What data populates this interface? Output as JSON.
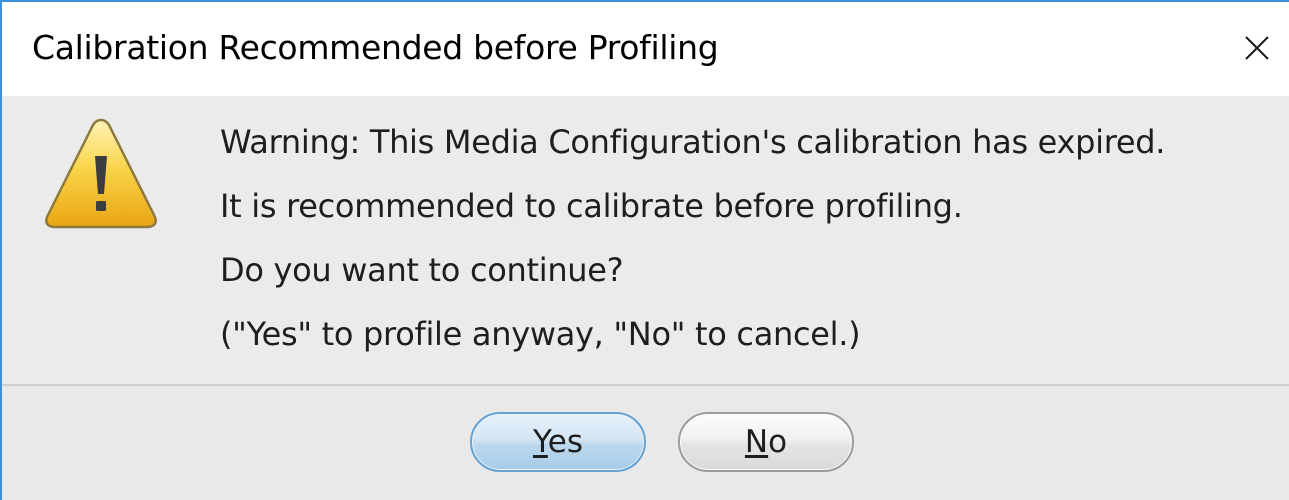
{
  "dialog": {
    "title": "Calibration Recommended before Profiling",
    "close_icon": "close-icon",
    "warning_icon": "warning-icon",
    "message_lines": [
      "Warning: This Media Configuration's calibration has expired.",
      "It is recommended to calibrate before profiling.",
      "Do you want to continue?",
      "(\"Yes\" to profile anyway, \"No\" to cancel.)"
    ],
    "buttons": {
      "yes": {
        "mnemonic": "Y",
        "rest": "es"
      },
      "no": {
        "mnemonic": "N",
        "rest": "o"
      }
    }
  },
  "colors": {
    "window_border": "#3c8fd8",
    "content_bg": "#ebebeb",
    "default_button_border": "#66a3d2",
    "warning_yellow": "#f2c21c"
  }
}
